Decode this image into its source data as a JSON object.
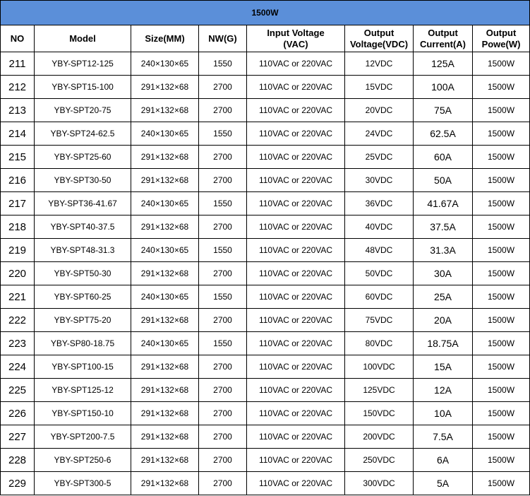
{
  "title": "1500W",
  "colors": {
    "title_bg": "#5b8fd9",
    "border": "#000000"
  },
  "headers": {
    "no": "NO",
    "model": "Model",
    "size": "Size(MM)",
    "nw": "NW(G)",
    "input_l1": "Input Voltage",
    "input_l2": "(VAC)",
    "out_v_l1": "Output",
    "out_v_l2": "Voltage(VDC)",
    "out_c_l1": "Output",
    "out_c_l2": "Current(A)",
    "out_p_l1": "Output",
    "out_p_l2": "Powe(W)"
  },
  "rows": [
    [
      "211",
      "YBY-SPT12-125",
      "240×130×65",
      "1550",
      "110VAC or 220VAC",
      "12VDC",
      "125A",
      "1500W"
    ],
    [
      "212",
      "YBY-SPT15-100",
      "291×132×68",
      "2700",
      "110VAC or 220VAC",
      "15VDC",
      "100A",
      "1500W"
    ],
    [
      "213",
      "YBY-SPT20-75",
      "291×132×68",
      "2700",
      "110VAC or 220VAC",
      "20VDC",
      "75A",
      "1500W"
    ],
    [
      "214",
      "YBY-SPT24-62.5",
      "240×130×65",
      "1550",
      "110VAC or 220VAC",
      "24VDC",
      "62.5A",
      "1500W"
    ],
    [
      "215",
      "YBY-SPT25-60",
      "291×132×68",
      "2700",
      "110VAC or 220VAC",
      "25VDC",
      "60A",
      "1500W"
    ],
    [
      "216",
      "YBY-SPT30-50",
      "291×132×68",
      "2700",
      "110VAC or 220VAC",
      "30VDC",
      "50A",
      "1500W"
    ],
    [
      "217",
      "YBY-SPT36-41.67",
      "240×130×65",
      "1550",
      "110VAC or 220VAC",
      "36VDC",
      "41.67A",
      "1500W"
    ],
    [
      "218",
      "YBY-SPT40-37.5",
      "291×132×68",
      "2700",
      "110VAC or 220VAC",
      "40VDC",
      "37.5A",
      "1500W"
    ],
    [
      "219",
      "YBY-SPT48-31.3",
      "240×130×65",
      "1550",
      "110VAC or 220VAC",
      "48VDC",
      "31.3A",
      "1500W"
    ],
    [
      "220",
      "YBY-SPT50-30",
      "291×132×68",
      "2700",
      "110VAC or 220VAC",
      "50VDC",
      "30A",
      "1500W"
    ],
    [
      "221",
      "YBY-SPT60-25",
      "240×130×65",
      "1550",
      "110VAC or 220VAC",
      "60VDC",
      "25A",
      "1500W"
    ],
    [
      "222",
      "YBY-SPT75-20",
      "291×132×68",
      "2700",
      "110VAC or 220VAC",
      "75VDC",
      "20A",
      "1500W"
    ],
    [
      "223",
      "YBY-SP80-18.75",
      "240×130×65",
      "1550",
      "110VAC or 220VAC",
      "80VDC",
      "18.75A",
      "1500W"
    ],
    [
      "224",
      "YBY-SPT100-15",
      "291×132×68",
      "2700",
      "110VAC or 220VAC",
      "100VDC",
      "15A",
      "1500W"
    ],
    [
      "225",
      "YBY-SPT125-12",
      "291×132×68",
      "2700",
      "110VAC or 220VAC",
      "125VDC",
      "12A",
      "1500W"
    ],
    [
      "226",
      "YBY-SPT150-10",
      "291×132×68",
      "2700",
      "110VAC or 220VAC",
      "150VDC",
      "10A",
      "1500W"
    ],
    [
      "227",
      "YBY-SPT200-7.5",
      "291×132×68",
      "2700",
      "110VAC or 220VAC",
      "200VDC",
      "7.5A",
      "1500W"
    ],
    [
      "228",
      "YBY-SPT250-6",
      "291×132×68",
      "2700",
      "110VAC or 220VAC",
      "250VDC",
      "6A",
      "1500W"
    ],
    [
      "229",
      "YBY-SPT300-5",
      "291×132×68",
      "2700",
      "110VAC or 220VAC",
      "300VDC",
      "5A",
      "1500W"
    ]
  ]
}
